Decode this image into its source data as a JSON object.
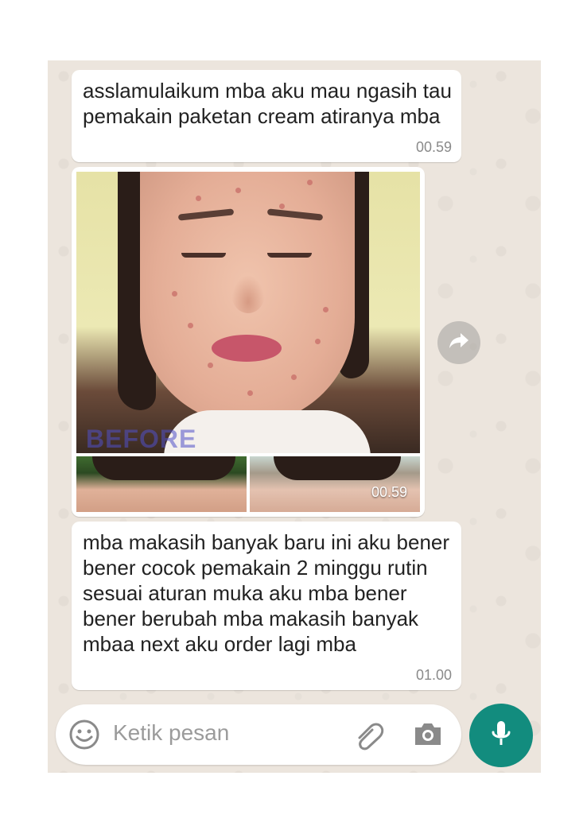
{
  "messages": [
    {
      "text": "asslamulaikum mba aku mau ngasih tau pemakain paketan cream atiranya mba",
      "time": "00.59"
    },
    {
      "type": "image",
      "image_label": "BEFORE",
      "time": "00.59"
    },
    {
      "text": "mba makasih banyak baru ini aku bener bener cocok pemakain 2 minggu rutin sesuai aturan muka aku mba bener bener berubah mba makasih banyak mbaa next aku order lagi mba",
      "time": "01.00"
    }
  ],
  "input": {
    "placeholder": "Ketik pesan"
  },
  "icons": {
    "emoji": "emoji-icon",
    "attach": "paperclip-icon",
    "camera": "camera-icon",
    "mic": "microphone-icon",
    "share": "forward-icon"
  },
  "colors": {
    "chat_background": "#ece5dd",
    "bubble": "#ffffff",
    "mic_button": "#128c7e"
  }
}
